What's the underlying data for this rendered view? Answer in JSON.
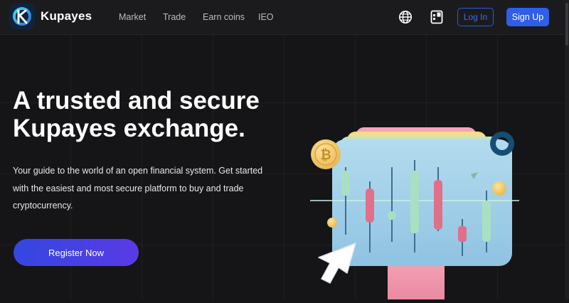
{
  "header": {
    "brand": "Kupayes",
    "nav": [
      "Market",
      "Trade",
      "Earn coins",
      "IEO"
    ],
    "login_label": "Log In",
    "signup_label": "Sign Up",
    "icons": [
      "globe-icon",
      "download-app-icon"
    ]
  },
  "hero": {
    "title_lines": [
      "A trusted and secure",
      "Kupayes exchange."
    ],
    "subtitle_lines": [
      "Your guide to the world of an open financial system. Get started",
      "with the easiest and most secure platform to buy and trade",
      "cryptocurrency."
    ],
    "cta_label": "Register Now"
  },
  "illustration": {
    "coin_symbol": "₿",
    "colors": {
      "accent": "#2f5fe8",
      "board": "#a9d4ec",
      "candle_green": "#a9e0c3",
      "candle_pink": "#e0708a",
      "coin": "#f2c96b"
    }
  }
}
